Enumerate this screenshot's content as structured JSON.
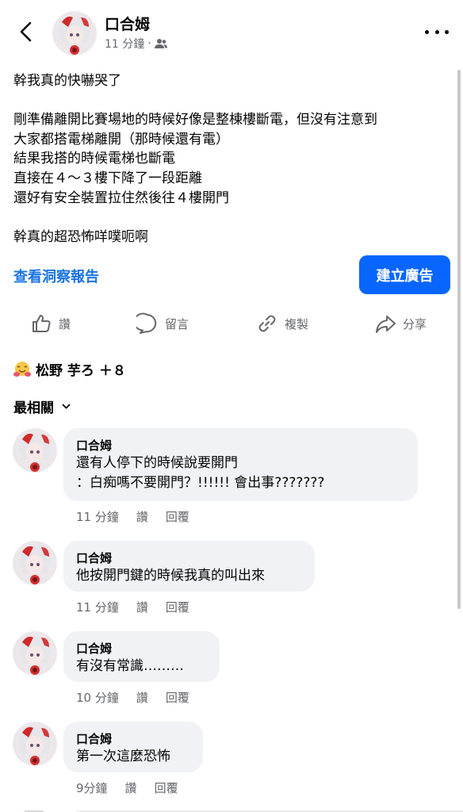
{
  "header": {
    "author": "口合姆",
    "time": "11 分鐘",
    "separator": "·",
    "audience_icon": "friends-icon"
  },
  "post": {
    "lines": [
      "幹我真的快嚇哭了",
      "",
      "剛準備離開比賽場地的時候好像是整棟樓斷電，但沒有注意到",
      "大家都搭電梯離開（那時候還有電）",
      "結果我搭的時候電梯也斷電",
      "直接在４～３樓下降了一段距離",
      "還好有安全裝置拉住然後往４樓開門",
      "",
      "幹真的超恐怖咩噗呃啊"
    ]
  },
  "insights": {
    "label": "查看洞察報告"
  },
  "create_ad": {
    "label": "建立廣告"
  },
  "actions": {
    "like": "讚",
    "comment": "留言",
    "copy": "複製",
    "share": "分享"
  },
  "reactions": {
    "emoji": "hugging-face",
    "text": "松野 芋ろ ＋８"
  },
  "sort": {
    "label": "最相關"
  },
  "comments": [
    {
      "name": "口合姆",
      "lines": [
        "還有人停下的時候說要開門",
        "：白痴嗎不要開門？!!!!!! 會出事???????"
      ],
      "time": "11 分鐘",
      "like": "讚",
      "reply": "回覆"
    },
    {
      "name": "口合姆",
      "lines": [
        "他按開門鍵的時候我真的叫出來"
      ],
      "time": "11 分鐘",
      "like": "讚",
      "reply": "回覆"
    },
    {
      "name": "口合姆",
      "lines": [
        "有沒有常識………"
      ],
      "time": "10 分鐘",
      "like": "讚",
      "reply": "回覆"
    },
    {
      "name": "口合姆",
      "lines": [
        "第一次這麼恐怖"
      ],
      "time": "9分鐘",
      "like": "讚",
      "reply": "回覆"
    }
  ],
  "colors": {
    "link_blue": "#1b74e4",
    "button_blue": "#0866ff",
    "bubble_bg": "#f0f2f5",
    "secondary_text": "#65676b"
  }
}
